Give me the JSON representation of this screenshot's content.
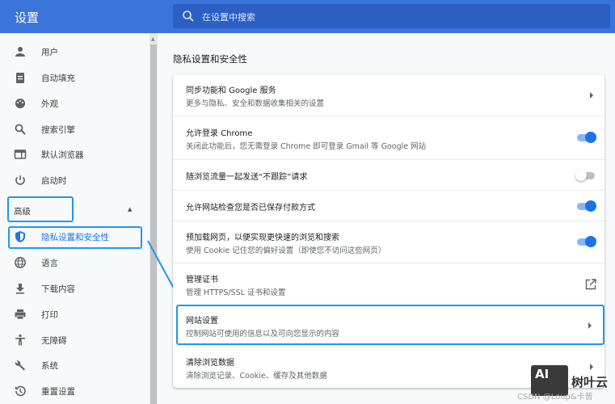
{
  "header": {
    "title": "设置",
    "search_placeholder": "在设置中搜索"
  },
  "sidebar": {
    "items": [
      {
        "label": "用户",
        "icon": "person-icon"
      },
      {
        "label": "自动填充",
        "icon": "clipboard-icon"
      },
      {
        "label": "外观",
        "icon": "palette-icon"
      },
      {
        "label": "搜索引擎",
        "icon": "search-icon"
      },
      {
        "label": "默认浏览器",
        "icon": "browser-icon"
      },
      {
        "label": "启动时",
        "icon": "power-icon"
      }
    ],
    "advanced_label": "高级",
    "advanced_items": [
      {
        "label": "隐私设置和安全性",
        "icon": "shield-icon"
      },
      {
        "label": "语言",
        "icon": "globe-icon"
      },
      {
        "label": "下载内容",
        "icon": "download-icon"
      },
      {
        "label": "打印",
        "icon": "printer-icon"
      },
      {
        "label": "无障碍",
        "icon": "accessibility-icon"
      },
      {
        "label": "系统",
        "icon": "wrench-icon"
      },
      {
        "label": "重置设置",
        "icon": "history-icon"
      }
    ]
  },
  "main": {
    "section_title": "隐私设置和安全性",
    "rows": [
      {
        "title": "同步功能和 Google 服务",
        "subtitle": "更多与隐私、安全和数据收集相关的设置",
        "control": "arrow"
      },
      {
        "title": "允许登录 Chrome",
        "subtitle": "关闭此功能后，您无需登录 Chrome 即可登录 Gmail 等 Google 网站",
        "control": "toggle",
        "on": true
      },
      {
        "title": "随浏览流量一起发送“不跟踪”请求",
        "control": "toggle",
        "on": false
      },
      {
        "title": "允许网站检查您是否已保存付款方式",
        "control": "toggle",
        "on": true
      },
      {
        "title": "预加载网页，以便实现更快速的浏览和搜索",
        "subtitle": "使用 Cookie 记住您的偏好设置（即使您不访问这些网页）",
        "control": "toggle",
        "on": true
      },
      {
        "title": "管理证书",
        "subtitle": "管理 HTTPS/SSL 证书和设置",
        "control": "external"
      },
      {
        "title": "网站设置",
        "subtitle": "控制网站可使用的信息以及可向您显示的内容",
        "control": "arrow"
      },
      {
        "title": "清除浏览数据",
        "subtitle": "清除浏览记录、Cookie、缓存及其他数据",
        "control": "arrow"
      }
    ]
  },
  "watermark": {
    "logo": "AI",
    "name": "树叶云",
    "credit": "CSDN @Loup&卡普"
  }
}
